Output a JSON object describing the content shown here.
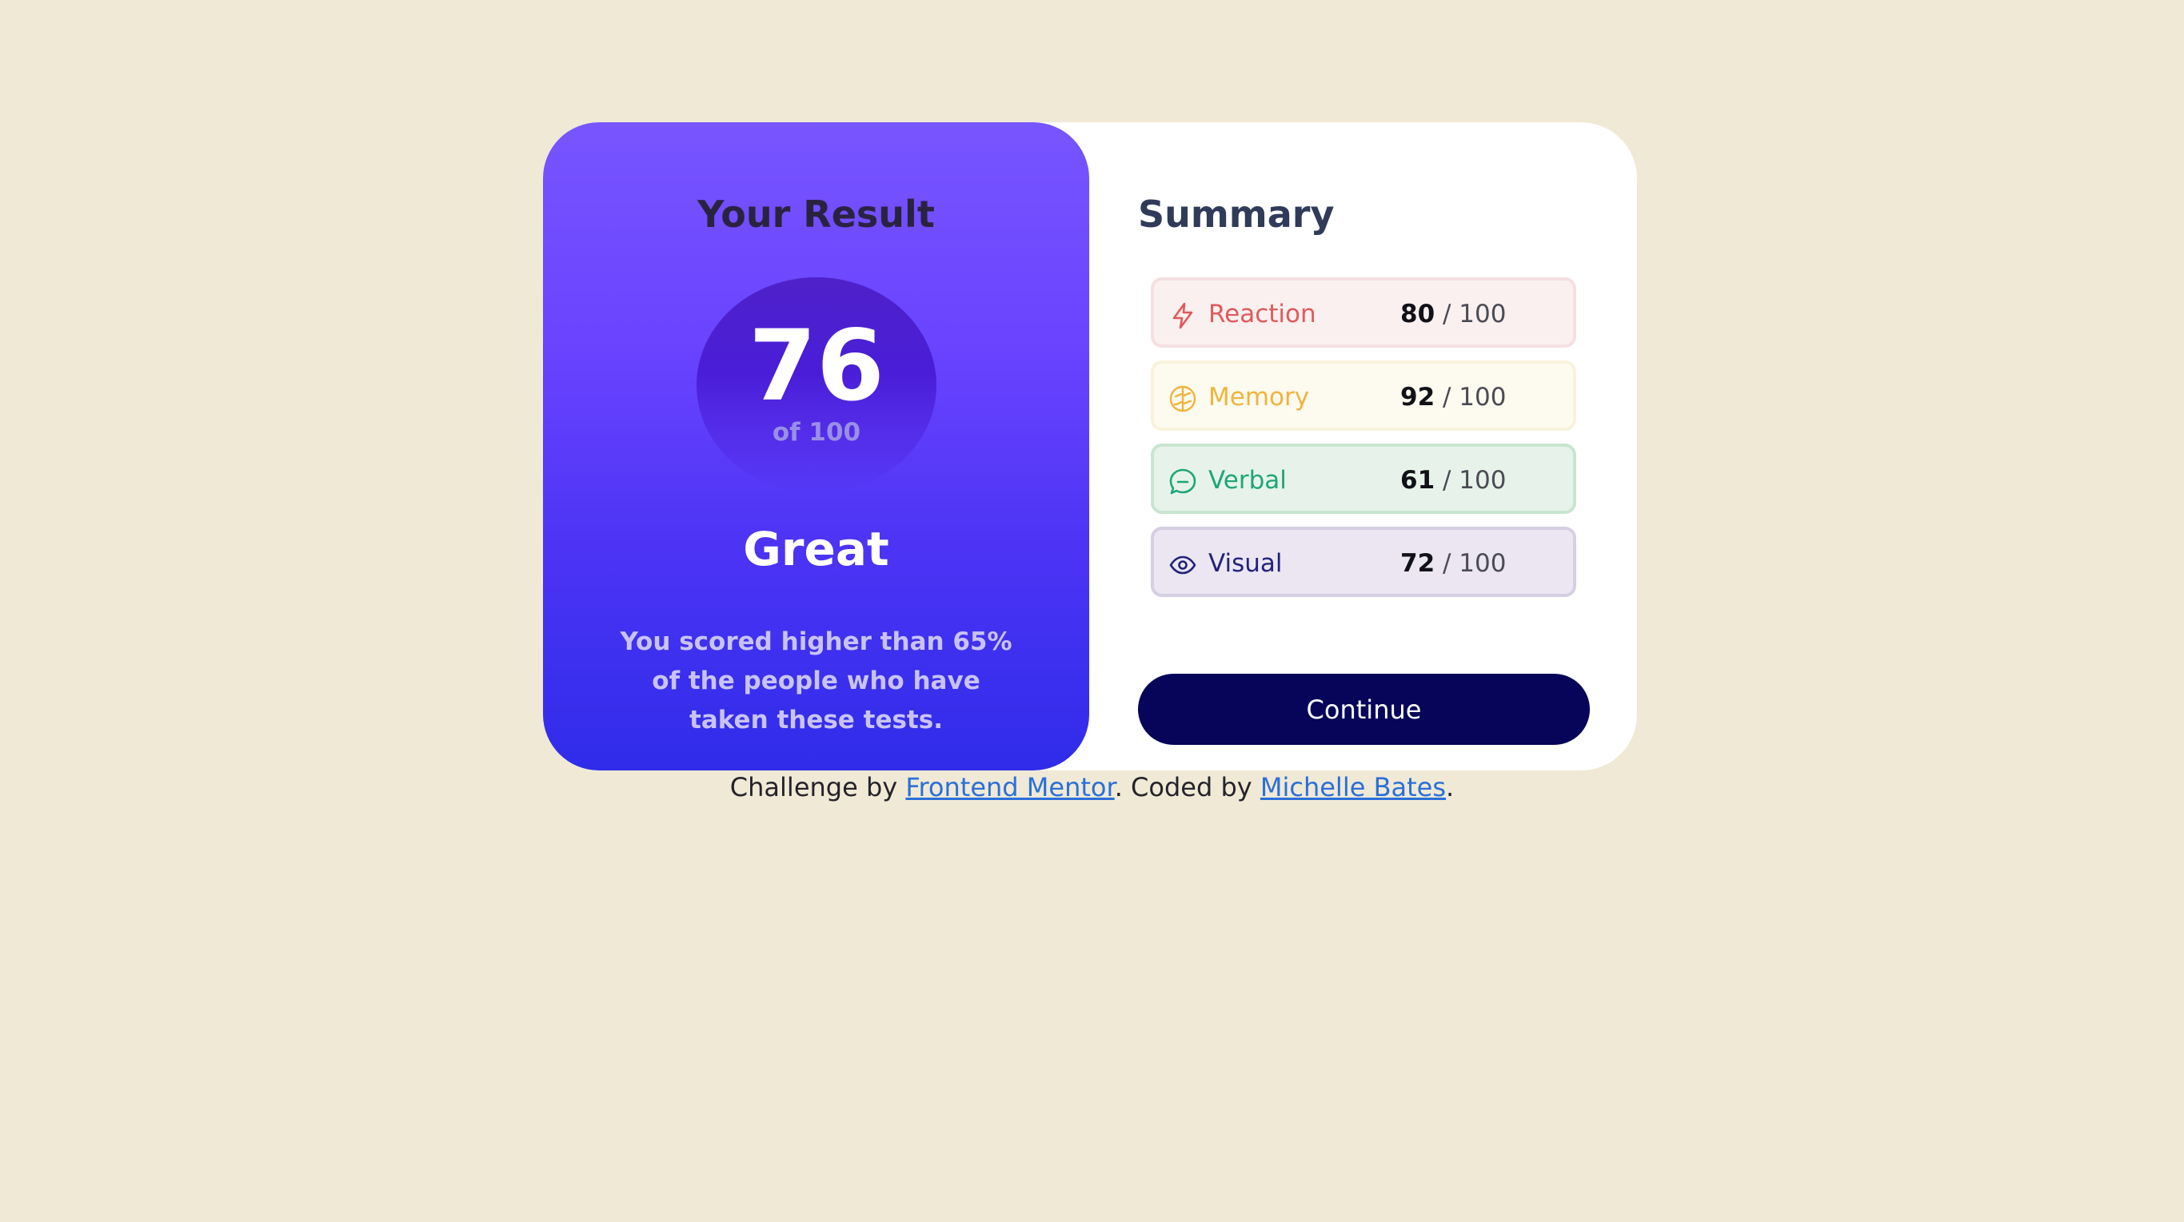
{
  "result": {
    "title": "Your Result",
    "score": "76",
    "score_of": "of 100",
    "rating": "Great",
    "description": "You scored higher than 65% of the people who have taken these tests."
  },
  "summary": {
    "title": "Summary",
    "items": [
      {
        "label": "Reaction",
        "score": "80",
        "max": "/ 100",
        "icon": "lightning-icon",
        "color": "#e05a5a"
      },
      {
        "label": "Memory",
        "score": "92",
        "max": "/ 100",
        "icon": "brain-icon",
        "color": "#f0b43c"
      },
      {
        "label": "Verbal",
        "score": "61",
        "max": "/ 100",
        "icon": "chat-bubble-icon",
        "color": "#1ea57a"
      },
      {
        "label": "Visual",
        "score": "72",
        "max": "/ 100",
        "icon": "eye-icon",
        "color": "#22237a"
      }
    ],
    "continue_label": "Continue"
  },
  "attribution": {
    "prefix": "Challenge by",
    "link1": "Frontend Mentor",
    "middle": ". Coded by",
    "link2": "Michelle Bates",
    "suffix": "."
  },
  "colors": {
    "background": "#efe9d6",
    "result_gradient_top": "#7755ff",
    "result_gradient_bottom": "#2f2ce9",
    "button": "#06055a"
  }
}
